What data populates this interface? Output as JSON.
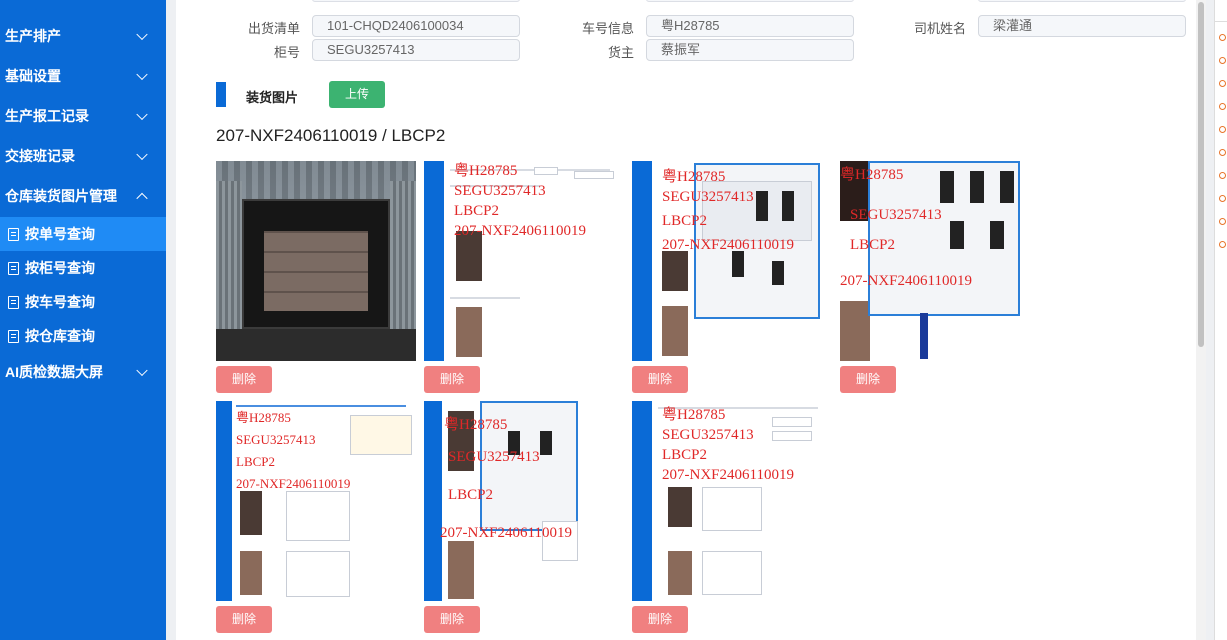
{
  "sidebar": {
    "items": [
      {
        "label": "生产排产"
      },
      {
        "label": "基础设置"
      },
      {
        "label": "生产报工记录"
      },
      {
        "label": "交接班记录"
      },
      {
        "label": "仓库装货图片管理"
      },
      {
        "label": "AI质检数据大屏"
      }
    ],
    "sub_items": [
      {
        "label": "按单号查询",
        "active": true
      },
      {
        "label": "按柜号查询"
      },
      {
        "label": "按车号查询"
      },
      {
        "label": "按仓库查询"
      }
    ]
  },
  "form": {
    "delivery_list_label": "出货清单",
    "delivery_list_value": "101-CHQD2406100034",
    "plate_label": "车号信息",
    "plate_value": "粤H28785",
    "driver_label": "司机姓名",
    "driver_value": "梁灌通",
    "container_label": "柜号",
    "container_value": "SEGU3257413",
    "owner_label": "货主",
    "owner_value": "蔡振军"
  },
  "section": {
    "title": "装货图片",
    "upload_label": "上传"
  },
  "group": {
    "title": "207-NXF2406110019 / LBCP2"
  },
  "overlay": {
    "plate": "粤H28785",
    "container": "SEGU3257413",
    "lbcp": "LBCP2",
    "order": "207-NXF2406110019"
  },
  "images": {
    "delete_label": "删除",
    "count": 7
  },
  "colors": {
    "sidebar": "#0a6ad6",
    "sidebar_active": "#1f8bf5",
    "upload": "#3cb371",
    "delete": "#f08080"
  }
}
